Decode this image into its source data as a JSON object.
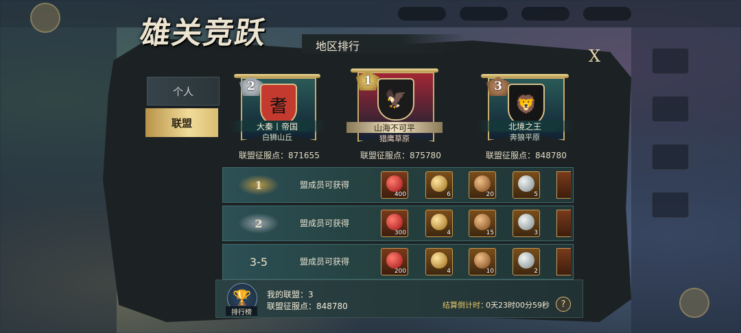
{
  "header": {
    "title": "雄关竞跃",
    "subtitle": "地区排行",
    "close_label": "X"
  },
  "tabs": {
    "personal": "个人",
    "alliance": "联盟"
  },
  "podium": [
    {
      "rank": "2",
      "alliance": "大秦丨帝国",
      "server": "白狮山丘",
      "score_label": "联盟征服点：",
      "score": "871655",
      "flag_color": "#2a5a58",
      "emblem_color": "#c53a2e",
      "emblem_icon": "seal-icon"
    },
    {
      "rank": "1",
      "alliance": "山海不可平",
      "server": "猎鹰草原",
      "score_label": "联盟征服点：",
      "score": "875780",
      "flag_color": "#a32634",
      "emblem_color": "#f2f0ec",
      "emblem_icon": "eagle-icon"
    },
    {
      "rank": "3",
      "alliance": "北境之王",
      "server": "奔狼平原",
      "score_label": "联盟征服点：",
      "score": "848780",
      "flag_color": "#2a5a58",
      "emblem_color": "#e0b23c",
      "emblem_icon": "lion-icon"
    }
  ],
  "rewards": [
    {
      "rank": "1",
      "label": "盟成员可获得",
      "items": [
        {
          "name": "ruby-icon",
          "count": "400"
        },
        {
          "name": "gold-helmet-icon",
          "count": "6"
        },
        {
          "name": "bronze-helmet-icon",
          "count": "20"
        },
        {
          "name": "silver-helmet-icon",
          "count": "5"
        }
      ]
    },
    {
      "rank": "2",
      "label": "盟成员可获得",
      "items": [
        {
          "name": "ruby-icon",
          "count": "300"
        },
        {
          "name": "gold-helmet-icon",
          "count": "4"
        },
        {
          "name": "bronze-helmet-icon",
          "count": "15"
        },
        {
          "name": "silver-helmet-icon",
          "count": "3"
        }
      ]
    },
    {
      "rank": "3-5",
      "label": "盟成员可获得",
      "items": [
        {
          "name": "ruby-icon",
          "count": "200"
        },
        {
          "name": "gold-helmet-icon",
          "count": "4"
        },
        {
          "name": "bronze-helmet-icon",
          "count": "10"
        },
        {
          "name": "silver-helmet-icon",
          "count": "2"
        }
      ]
    }
  ],
  "footer": {
    "leaderboard_label": "排行榜",
    "my_alliance": "我的联盟：3",
    "my_score": "联盟征服点：848780",
    "countdown_label": "结算倒计时：",
    "countdown": "0天23时00分59秒",
    "help": "?"
  },
  "colors": {
    "gold": "#e7cf86",
    "ruby": "#c8322c",
    "bronze": "#c98a3a",
    "silver": "#b7c0c2"
  }
}
